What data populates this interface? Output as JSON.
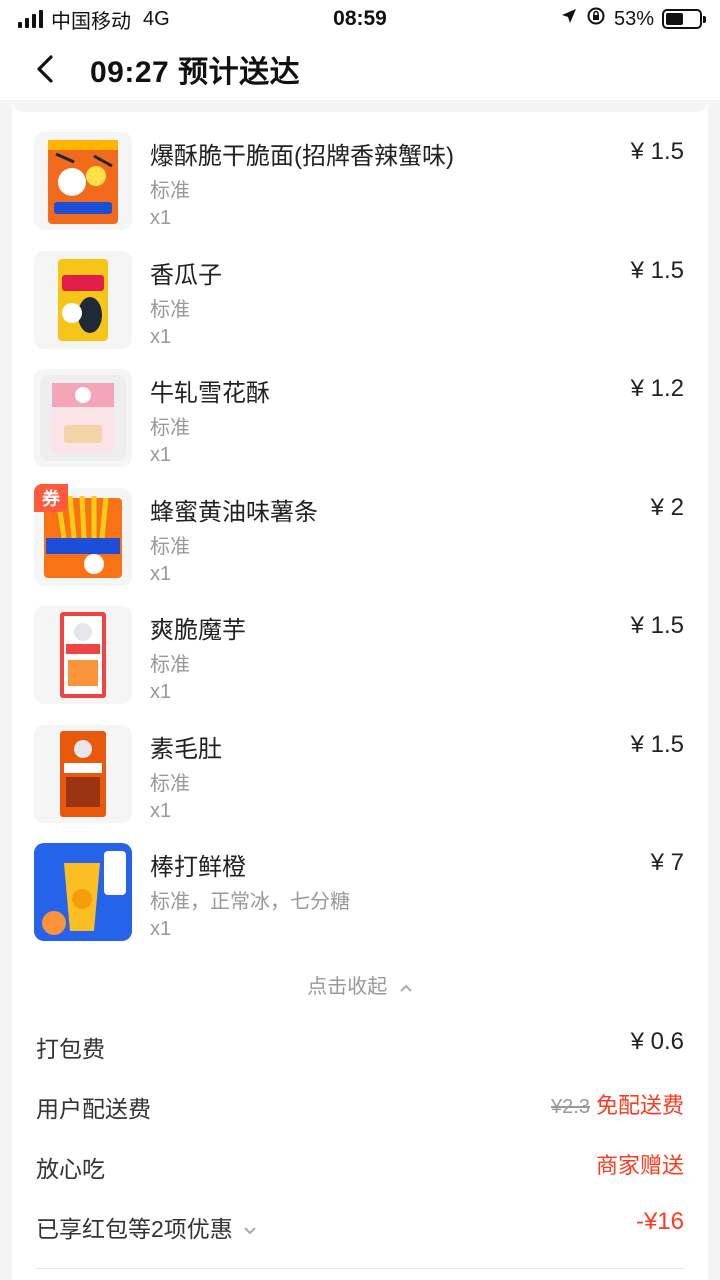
{
  "status_bar": {
    "carrier": "中国移动",
    "network": "4G",
    "time": "08:59",
    "battery": "53%",
    "battery_level": 0.53
  },
  "header": {
    "title": "09:27 预计送达"
  },
  "items": [
    {
      "name": "爆酥脆干脆面(招牌香辣蟹味)",
      "spec": "标准",
      "qty": "x1",
      "price": "¥ 1.5",
      "coupon": ""
    },
    {
      "name": "香瓜子",
      "spec": "标准",
      "qty": "x1",
      "price": "¥ 1.5",
      "coupon": ""
    },
    {
      "name": "牛轧雪花酥",
      "spec": "标准",
      "qty": "x1",
      "price": "¥ 1.2",
      "coupon": ""
    },
    {
      "name": "蜂蜜黄油味薯条",
      "spec": "标准",
      "qty": "x1",
      "price": "¥ 2",
      "coupon": "券"
    },
    {
      "name": "爽脆魔芋",
      "spec": "标准",
      "qty": "x1",
      "price": "¥ 1.5",
      "coupon": ""
    },
    {
      "name": "素毛肚",
      "spec": "标准",
      "qty": "x1",
      "price": "¥ 1.5",
      "coupon": ""
    },
    {
      "name": "棒打鲜橙",
      "spec": "标准，正常冰，七分糖",
      "qty": "x1",
      "price": "¥ 7",
      "coupon": ""
    }
  ],
  "collapse_label": "点击收起",
  "fees": {
    "packing": {
      "label": "打包费",
      "value": "¥ 0.6"
    },
    "delivery": {
      "label": "用户配送费",
      "original": "¥2.3",
      "value": "免配送费"
    },
    "assurance": {
      "label": "放心吃",
      "value": "商家赠送"
    },
    "discount": {
      "label": "已享红包等2项优惠",
      "value": "-¥16"
    }
  },
  "colors": {
    "accent_red": "#ff3b1f",
    "coupon_bg": "#ff5a3c",
    "muted_text": "#999999"
  }
}
